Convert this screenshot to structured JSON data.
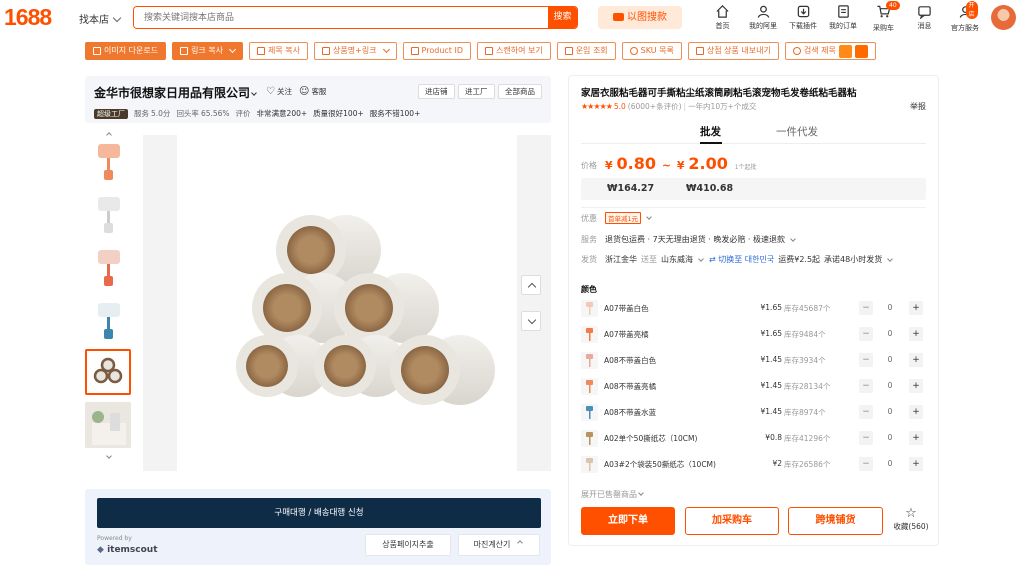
{
  "header": {
    "logo": "1688",
    "find_shop": "找本店",
    "search_placeholder": "搜索关键词搜本店商品",
    "search_button": "搜索",
    "image_search": "以图搜款",
    "nav": [
      {
        "label": "首页",
        "icon": "home-icon"
      },
      {
        "label": "我的阿里",
        "icon": "user-icon"
      },
      {
        "label": "下载插件",
        "icon": "download-icon"
      },
      {
        "label": "我的订单",
        "icon": "order-icon"
      },
      {
        "label": "采购车",
        "icon": "cart-icon",
        "badge": "40"
      },
      {
        "label": "消息",
        "icon": "message-icon"
      },
      {
        "label": "官方服务",
        "icon": "service-icon",
        "badge": "开店"
      }
    ]
  },
  "toolbar": {
    "buttons": [
      "이미지 다운로드",
      "링크 복사",
      "제목 복사",
      "상품명+링크",
      "Product ID",
      "스캔하여 보기",
      "운임 조회",
      "SKU 목록",
      "상점 상품 내보내기",
      "검색 제목"
    ]
  },
  "shop": {
    "name": "金华市很想家日用品有限公司",
    "follow": "关注",
    "service": "客服",
    "btn_enter": "进店铺",
    "btn_factory": "进工厂",
    "btn_all": "全部商品",
    "level": "超级工厂",
    "stats": [
      "服务",
      "5.0分",
      "回头率",
      "65.56%",
      "评价",
      "非常满意200+",
      "质量很好100+",
      "服务不错100+"
    ]
  },
  "extension": {
    "main_button": "구매대행 / 배송대행 신청",
    "powered_by": "Powered by",
    "brand": "itemscout",
    "btn_extract": "상품페이지추출",
    "btn_margin": "마진계산기"
  },
  "product": {
    "title": "家居衣服粘毛器可手撕粘尘纸滚筒刷粘毛滚宠物毛发卷纸粘毛器粘",
    "rating_stars": "★★★★★",
    "rating_score": "5.0",
    "review_count": "(6000+条评价)",
    "sold": "一年内10万+个成交",
    "report": "举报",
    "tabs": [
      "批发",
      "一件代发"
    ],
    "price_label": "价格",
    "price_low": "0.80",
    "price_high": "2.00",
    "currency": "¥",
    "min_order": "1个起批",
    "krw_low": "₩164.27",
    "krw_high": "₩410.68",
    "promo_label": "优惠",
    "promo_coupon": "首单减1元",
    "service_label": "服务",
    "service_text": "退货包运费 · 7天无理由退货 · 晚发必赔 · 极速退款",
    "ship_label": "发货",
    "ship_from": "浙江金华",
    "ship_to_word": "送至",
    "ship_to": "山东威海",
    "switch": "切换至 대한민국",
    "freight": "运费¥2.5起",
    "promise": "承诺48小时发货",
    "color_label": "颜色",
    "variants": [
      {
        "name": "A07带盖白色",
        "price": "¥1.65",
        "stock": "库存45687个",
        "qty": "0",
        "color": "#f2c9b5"
      },
      {
        "name": "A07带盖亮橘",
        "price": "¥1.65",
        "stock": "库存9484个",
        "qty": "0",
        "color": "#f47a4a"
      },
      {
        "name": "A08不带盖白色",
        "price": "¥1.45",
        "stock": "库存3934个",
        "qty": "0",
        "color": "#e9a99a"
      },
      {
        "name": "A08不带盖亮橘",
        "price": "¥1.45",
        "stock": "库存28134个",
        "qty": "0",
        "color": "#f08a5c"
      },
      {
        "name": "A08不带盖水蓝",
        "price": "¥1.45",
        "stock": "库存8974个",
        "qty": "0",
        "color": "#4a8fb5"
      },
      {
        "name": "A02单个50撕纸芯（10CM)",
        "price": "¥0.8",
        "stock": "库存41296个",
        "qty": "0",
        "color": "#b8935f"
      },
      {
        "name": "A03#2个袋装50撕纸芯（10CM)",
        "price": "¥2",
        "stock": "库存26586个",
        "qty": "0",
        "color": "#d8c7ad"
      }
    ],
    "more_products": "展开已售罄商品",
    "buy_now": "立即下单",
    "add_cart": "加采购车",
    "cross_border": "跨境铺货",
    "favorite": "收藏",
    "favorite_count": "(560)"
  },
  "colors": {
    "accent": "#ff5000",
    "dark_button": "#0f2c47"
  }
}
